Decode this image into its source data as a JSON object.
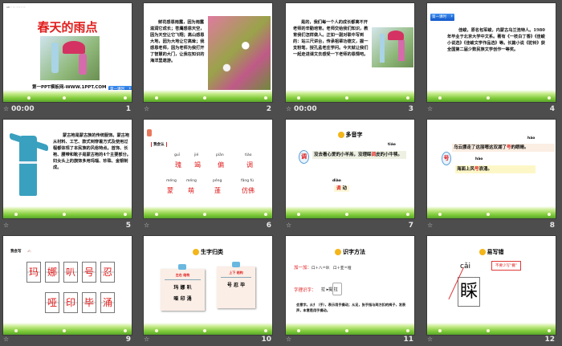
{
  "slides": [
    {
      "num": "1",
      "time": "00:00",
      "title": "春天的雨点",
      "header": "A8 ◦ ◦◦ ◦◦◦◦ ◦◦",
      "site": "第一PPT模板网-WWW.1PPT.COM",
      "btn1": "第一课时",
      "btn2": "第二课时"
    },
    {
      "num": "2",
      "text": "鲜花感恩雨露，因为雨露滋润它成长；苍鹰感恩天空，因为天空让它飞翔；高山感恩大地，因为大地让它高耸；我感恩老师，因为老师为我打开了智慧的大门，让我在知识的海洋里遨游。"
    },
    {
      "num": "3",
      "time": "00:00",
      "text": "是的，我们每一个人的成长都离不开老师的辛勤培育。老师交给我们知识，教育我们怎样做人。正如一副对联中写到的：站三尺讲台，传承祖辈功德文，握一支粉笔，授孔孟老庄学问。今天就让我们一起走进课文去感受一下老师的恩情吧。"
    },
    {
      "num": "4",
      "btn": "第一课时",
      "text": "佳峻，原名包军峻，内蒙古乌兰浩特人。1980年毕业于北京大学中文系。著有《一枝白丁香》《佳峻小说选》《佳峻文学作品选》等。长篇小说《驼铃》获全国第二届少数民族文学创作一等奖。"
    },
    {
      "num": "5",
      "text": "蒙古袍是蒙古族的传统服饰。蒙古袍从材料、工艺、款式到穿着方式及使用过程都体现了本民族的风俗特点。首饰、长袍、腰带和靴子是蒙古袍的4个主要部分。妇女头上的旗饰多用玛瑙、珍珠、金银制成。"
    },
    {
      "num": "6",
      "label": "我会认",
      "row1": [
        {
          "py": "guī",
          "ch": "瑰"
        },
        {
          "py": "jié",
          "ch": "竭"
        },
        {
          "py": "piān",
          "ch": "偏"
        },
        {
          "py": "tiáo",
          "ch": "调"
        }
      ],
      "row2": [
        {
          "py": "méng",
          "ch": "蒙"
        },
        {
          "py": "méng",
          "ch": "萌"
        },
        {
          "py": "péng",
          "ch": "蓬"
        },
        {
          "py": "fǎng fú",
          "ch": "仿佛"
        }
      ]
    },
    {
      "num": "7",
      "title": "多音字",
      "char": "调",
      "py1": "tiáo",
      "sentence_a": "没去看心爱的小羊羔，没理睬",
      "sentence_hl": "调",
      "sentence_b": "皮的小牛犊。",
      "py2": "diào",
      "word_a": "调",
      "word_b": "动"
    },
    {
      "num": "8",
      "char": "号",
      "py1": "háo",
      "s1a": "乌云挪走了这丽嗯这双湖了",
      "s1hl": "号",
      "s1b": "的眼睛。",
      "py2": "hào",
      "s2a": "海面上风",
      "s2hl": "号",
      "s2b": "浪涌。"
    },
    {
      "num": "9",
      "label": "我会写",
      "row1": [
        "玛",
        "娜",
        "叭",
        "号",
        "忍"
      ],
      "row2": [
        "哑",
        "印",
        "毕",
        "涌"
      ]
    },
    {
      "num": "10",
      "title": "生字归类",
      "card1": {
        "head": "左右 结构",
        "l1": "玛 娜 叭",
        "l2": "哑 印 涌"
      },
      "card2": {
        "head": "上下 结构",
        "l1": "号 忍 毕"
      }
    },
    {
      "num": "11",
      "title": "识字方法",
      "m1_label": "加一加：",
      "m1_text": "口＋八＝叭　口＋亚＝哑",
      "m2_label": "字理识字：",
      "m2_chars": "拉  ▸提 拉",
      "desc": "会意字。从扌（手），表示用手操动；从足，张手指与两方扣的拇子，发表声，本意是用手操动。"
    },
    {
      "num": "12",
      "title": "易写错",
      "py": "cǎi",
      "char": "睬",
      "note": "不要少写“撇”"
    }
  ]
}
